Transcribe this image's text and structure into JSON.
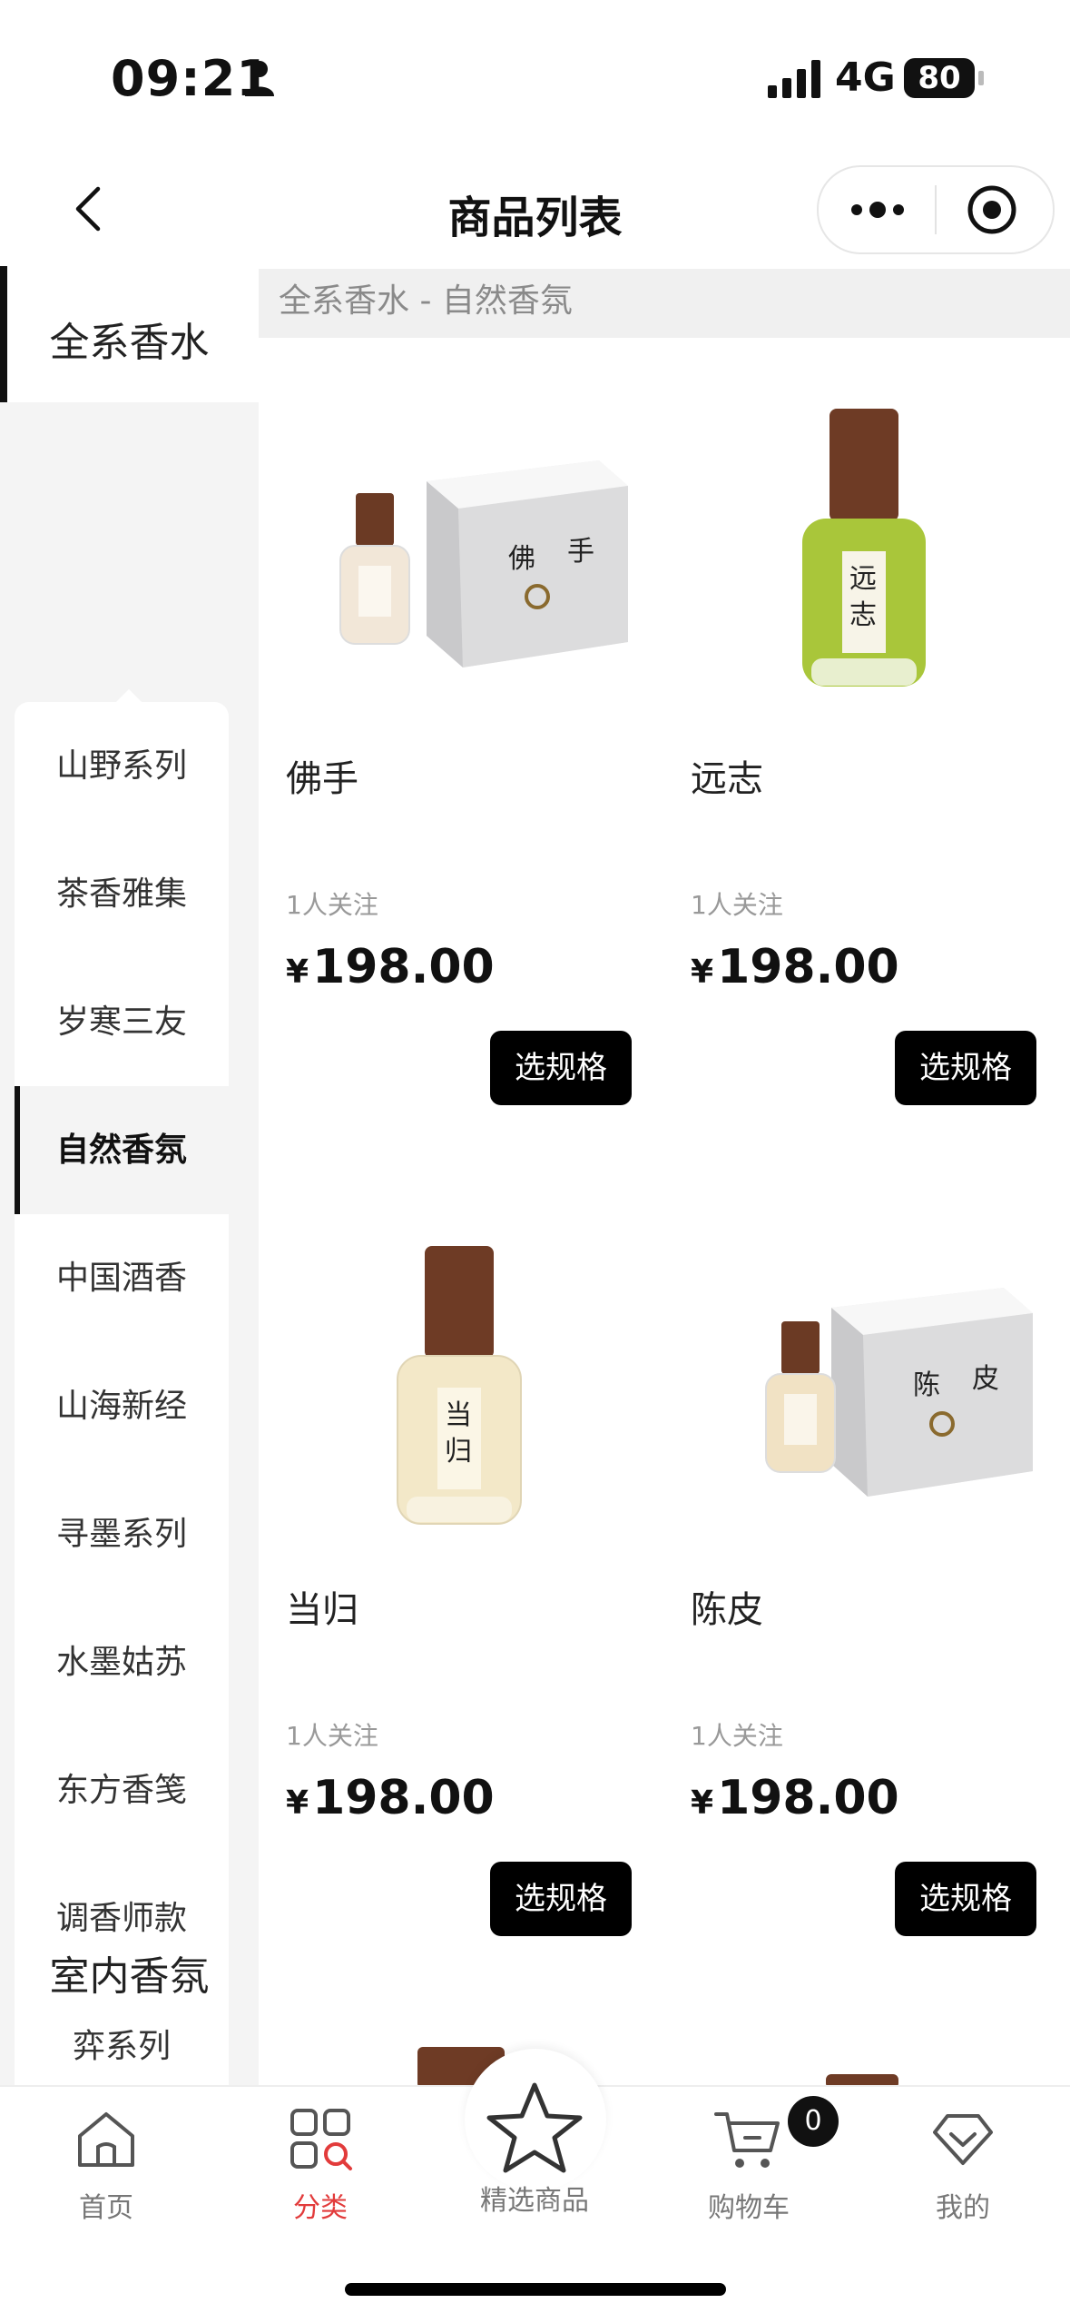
{
  "status_bar": {
    "time": "09:21",
    "network": "4G",
    "battery": "80"
  },
  "header": {
    "title": "商品列表"
  },
  "sidebar": {
    "categories": [
      {
        "label": "全系香水"
      },
      {
        "label": "室内香氛"
      }
    ],
    "sub_items": [
      {
        "label": "山野系列"
      },
      {
        "label": "茶香雅集"
      },
      {
        "label": "岁寒三友"
      },
      {
        "label": "自然香氛",
        "active": true
      },
      {
        "label": "中国酒香"
      },
      {
        "label": "山海新经"
      },
      {
        "label": "寻墨系列"
      },
      {
        "label": "水墨姑苏"
      },
      {
        "label": "东方香笺"
      },
      {
        "label": "调香师款"
      },
      {
        "label": "弈系列"
      }
    ]
  },
  "breadcrumb": "全系香水 - 自然香氛",
  "products": [
    {
      "name": "佛手",
      "follow": "1人关注",
      "currency": "¥",
      "price": "198.00",
      "button": "选规格",
      "label_chars": [
        "佛",
        "手"
      ]
    },
    {
      "name": "远志",
      "follow": "1人关注",
      "currency": "¥",
      "price": "198.00",
      "button": "选规格",
      "label_chars": [
        "远",
        "志"
      ]
    },
    {
      "name": "当归",
      "follow": "1人关注",
      "currency": "¥",
      "price": "198.00",
      "button": "选规格",
      "label_chars": [
        "当",
        "归"
      ]
    },
    {
      "name": "陈皮",
      "follow": "1人关注",
      "currency": "¥",
      "price": "198.00",
      "button": "选规格",
      "label_chars": [
        "陈",
        "皮"
      ]
    }
  ],
  "tabbar": {
    "items": [
      {
        "label": "首页",
        "icon": "home-icon"
      },
      {
        "label": "分类",
        "icon": "category-icon",
        "active": true
      },
      {
        "label": "精选商品",
        "icon": "star-icon"
      },
      {
        "label": "购物车",
        "icon": "cart-icon"
      },
      {
        "label": "我的",
        "icon": "diamond-icon"
      }
    ],
    "cart_count": "0"
  },
  "colors": {
    "accent_active_tab": "#e23b3b",
    "button_bg": "#000000",
    "sidebar_bg": "#f4f4f4"
  }
}
